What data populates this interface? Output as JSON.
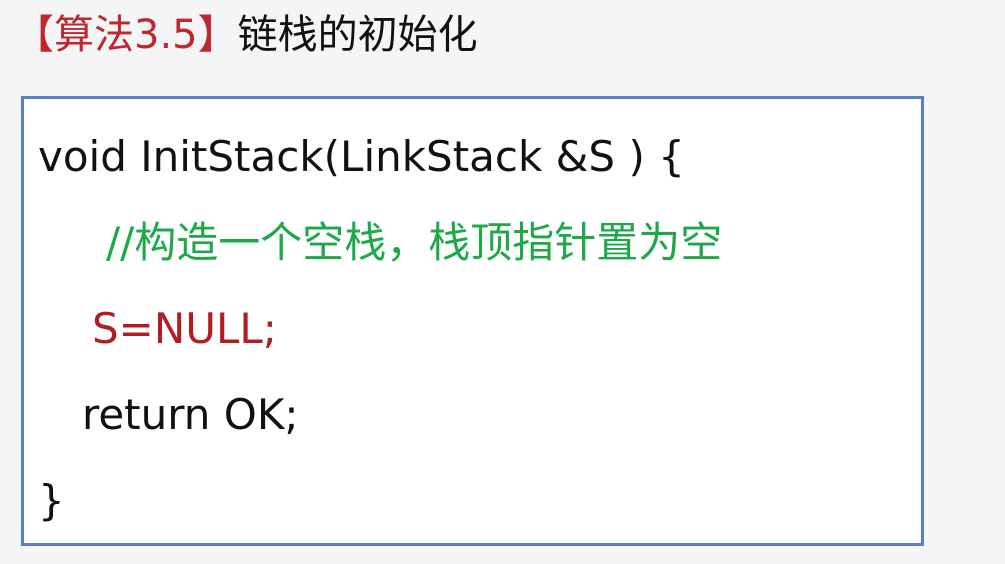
{
  "slide": {
    "algo_label": "【算法3.5】",
    "title": "链栈的初始化"
  },
  "code": {
    "lines": [
      "void InitStack(LinkStack &S ) {",
      "//构造一个空栈，栈顶指针置为空",
      "S=NULL;",
      "return OK;",
      "}"
    ]
  },
  "colors": {
    "algo_label": "#c0262d",
    "comment": "#1fa84a",
    "highlight_statement": "#b01e24",
    "box_border": "#5b7ec6"
  }
}
